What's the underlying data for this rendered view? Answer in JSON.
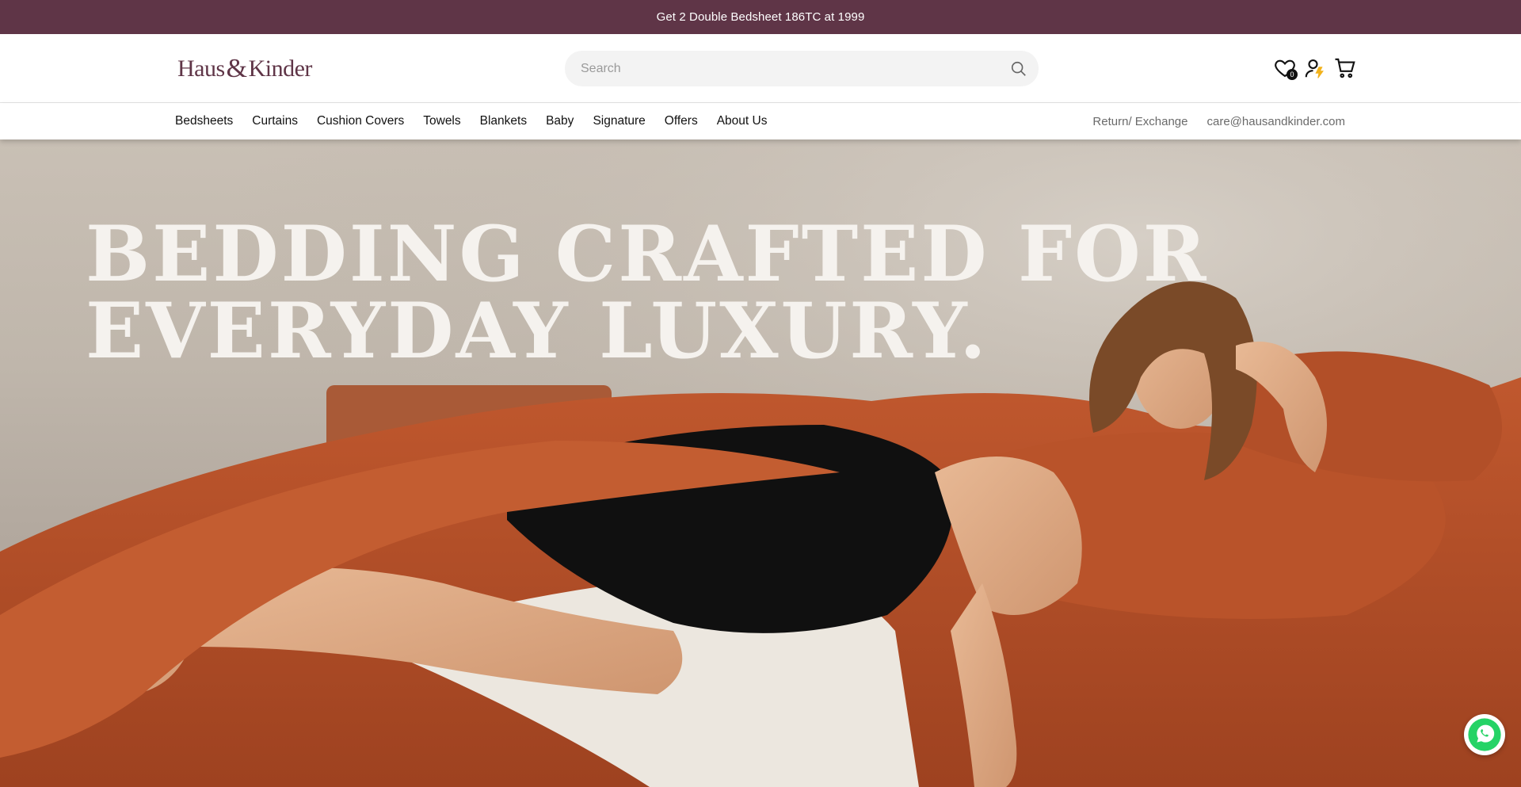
{
  "announcement": {
    "text": "Get 2 Double Bedsheet 186TC at 1999"
  },
  "header": {
    "logo": {
      "part1": "Haus",
      "amp": "&",
      "part2": "Kinder"
    },
    "search": {
      "placeholder": "Search",
      "value": ""
    },
    "wishlist_count": "0",
    "icons": [
      "heart-icon",
      "user-icon",
      "cart-icon"
    ]
  },
  "nav": {
    "items": [
      "Bedsheets",
      "Curtains",
      "Cushion Covers",
      "Towels",
      "Blankets",
      "Baby",
      "Signature",
      "Offers",
      "About Us"
    ],
    "right_links": [
      "Return/ Exchange",
      "care@hausandkinder.com"
    ]
  },
  "hero": {
    "title_line1": "BEDDING CRAFTED FOR",
    "title_line2": "EVERYDAY LUXURY."
  },
  "colors": {
    "brand": "#5f3547",
    "bedding": "#b4502a",
    "whatsapp": "#25d366"
  }
}
